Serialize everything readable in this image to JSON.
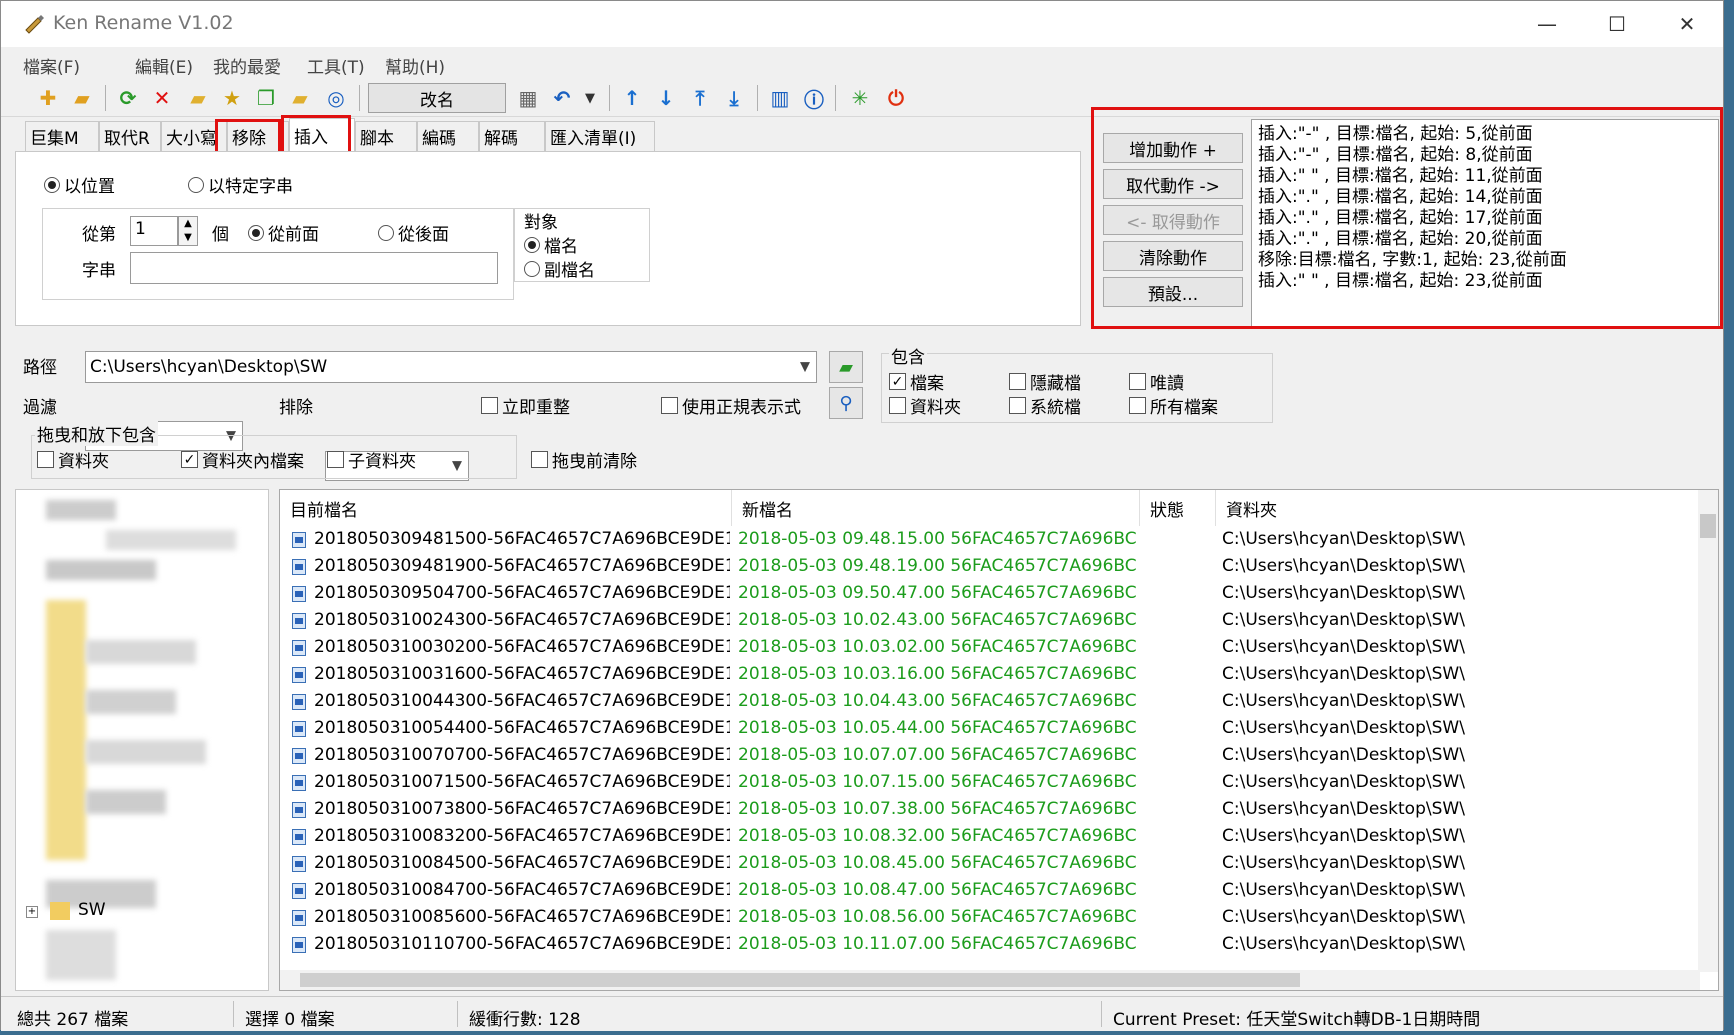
{
  "window": {
    "title": "Ken Rename V1.02",
    "minimize": "—",
    "maximize": "☐",
    "close": "✕"
  },
  "menu": [
    "檔案(F)",
    "編輯(E)",
    "我的最愛",
    "工具(T)",
    "幫助(H)"
  ],
  "toolbar": {
    "rename_label": "改名"
  },
  "tabs": [
    "巨集M",
    "取代R",
    "大小寫",
    "移除",
    "插入",
    "腳本",
    "編碼",
    "解碼",
    "匯入清單(I)"
  ],
  "insert_panel": {
    "mode_by_position": "以位置",
    "mode_by_string": "以特定字串",
    "from_label": "從第",
    "position_value": "1",
    "unit_label": "個",
    "from_front": "從前面",
    "from_back": "從後面",
    "string_label": "字串",
    "string_value": "",
    "target_title": "對象",
    "target_filename": "檔名",
    "target_extension": "副檔名"
  },
  "actions": {
    "add": "增加動作 +",
    "replace": "取代動作 ->",
    "get": "<- 取得動作",
    "clear": "清除動作",
    "preset": "預設...",
    "list": [
      "插入:\"-\" , 目標:檔名, 起始: 5,從前面",
      "插入:\"-\" , 目標:檔名, 起始: 8,從前面",
      "插入:\" \" , 目標:檔名, 起始: 11,從前面",
      "插入:\".\" , 目標:檔名, 起始: 14,從前面",
      "插入:\".\" , 目標:檔名, 起始: 17,從前面",
      "插入:\".\" , 目標:檔名, 起始: 20,從前面",
      "移除:目標:檔名, 字數:1, 起始: 23,從前面",
      "插入:\" \" , 目標:檔名, 起始: 23,從前面"
    ]
  },
  "path": {
    "label": "路徑",
    "value": "C:\\Users\\hcyan\\Desktop\\SW",
    "filter_label": "過濾",
    "filter_value": "*.*",
    "exclude_label": "排除",
    "exclude_value": "",
    "instant_refresh": "立即重整",
    "use_regex": "使用正規表示式"
  },
  "include": {
    "title": "包含",
    "files": "檔案",
    "folders": "資料夾",
    "hidden": "隱藏檔",
    "system": "系統檔",
    "readonly": "唯讀",
    "all_files": "所有檔案"
  },
  "dragdrop": {
    "title": "拖曳和放下包含",
    "folder": "資料夾",
    "files_in_folder": "資料夾內檔案",
    "subfolder": "子資料夾",
    "clear_before": "拖曳前清除"
  },
  "tree": {
    "sw_label": "SW",
    "expand": "+"
  },
  "columns": {
    "current": "目前檔名",
    "new": "新檔名",
    "status": "狀態",
    "folder": "資料夾"
  },
  "files": [
    {
      "current": "20180503094815​00-56FAC4657C7A696BCE9DE14",
      "new": "2018-05-03 09.48.15.00 56FAC4657C7A696BCE9DE1",
      "folder": "C:\\Users\\hcyan\\Desktop\\SW\\"
    },
    {
      "current": "2018050309481900-56FAC4657C7A696BCE9DE14",
      "new": "2018-05-03 09.48.19.00 56FAC4657C7A696BCE9DE1",
      "folder": "C:\\Users\\hcyan\\Desktop\\SW\\"
    },
    {
      "current": "2018050309504700-56FAC4657C7A696BCE9DE14",
      "new": "2018-05-03 09.50.47.00 56FAC4657C7A696BCE9DE1",
      "folder": "C:\\Users\\hcyan\\Desktop\\SW\\"
    },
    {
      "current": "2018050310024300-56FAC4657C7A696BCE9DE14",
      "new": "2018-05-03 10.02.43.00 56FAC4657C7A696BCE9DE1",
      "folder": "C:\\Users\\hcyan\\Desktop\\SW\\"
    },
    {
      "current": "2018050310030200-56FAC4657C7A696BCE9DE14",
      "new": "2018-05-03 10.03.02.00 56FAC4657C7A696BCE9DE1",
      "folder": "C:\\Users\\hcyan\\Desktop\\SW\\"
    },
    {
      "current": "2018050310031600-56FAC4657C7A696BCE9DE14",
      "new": "2018-05-03 10.03.16.00 56FAC4657C7A696BCE9DE1",
      "folder": "C:\\Users\\hcyan\\Desktop\\SW\\"
    },
    {
      "current": "2018050310044300-56FAC4657C7A696BCE9DE14",
      "new": "2018-05-03 10.04.43.00 56FAC4657C7A696BCE9DE1",
      "folder": "C:\\Users\\hcyan\\Desktop\\SW\\"
    },
    {
      "current": "2018050310054400-56FAC4657C7A696BCE9DE14",
      "new": "2018-05-03 10.05.44.00 56FAC4657C7A696BCE9DE1",
      "folder": "C:\\Users\\hcyan\\Desktop\\SW\\"
    },
    {
      "current": "2018050310070700-56FAC4657C7A696BCE9DE14",
      "new": "2018-05-03 10.07.07.00 56FAC4657C7A696BCE9DE1",
      "folder": "C:\\Users\\hcyan\\Desktop\\SW\\"
    },
    {
      "current": "2018050310071500-56FAC4657C7A696BCE9DE14",
      "new": "2018-05-03 10.07.15.00 56FAC4657C7A696BCE9DE1",
      "folder": "C:\\Users\\hcyan\\Desktop\\SW\\"
    },
    {
      "current": "2018050310073800-56FAC4657C7A696BCE9DE14",
      "new": "2018-05-03 10.07.38.00 56FAC4657C7A696BCE9DE1",
      "folder": "C:\\Users\\hcyan\\Desktop\\SW\\"
    },
    {
      "current": "2018050310083200-56FAC4657C7A696BCE9DE14",
      "new": "2018-05-03 10.08.32.00 56FAC4657C7A696BCE9DE1",
      "folder": "C:\\Users\\hcyan\\Desktop\\SW\\"
    },
    {
      "current": "2018050310084500-56FAC4657C7A696BCE9DE14",
      "new": "2018-05-03 10.08.45.00 56FAC4657C7A696BCE9DE1",
      "folder": "C:\\Users\\hcyan\\Desktop\\SW\\"
    },
    {
      "current": "2018050310084700-56FAC4657C7A696BCE9DE14",
      "new": "2018-05-03 10.08.47.00 56FAC4657C7A696BCE9DE1",
      "folder": "C:\\Users\\hcyan\\Desktop\\SW\\"
    },
    {
      "current": "2018050310085600-56FAC4657C7A696BCE9DE14",
      "new": "2018-05-03 10.08.56.00 56FAC4657C7A696BCE9DE1",
      "folder": "C:\\Users\\hcyan\\Desktop\\SW\\"
    },
    {
      "current": "2018050310110700-56FAC4657C7A696BCE9DE14",
      "new": "2018-05-03 10.11.07.00 56FAC4657C7A696BCE9DE1",
      "folder": "C:\\Users\\hcyan\\Desktop\\SW\\"
    }
  ],
  "status": {
    "total": "總共 267 檔案",
    "selected": "選擇 0 檔案",
    "buffer": "緩衝行數: 128",
    "preset": "Current Preset: 任天堂Switch轉DB-1日期時間"
  },
  "colors": {
    "highlight": "#e01010",
    "new_name": "#1c9c1c"
  }
}
